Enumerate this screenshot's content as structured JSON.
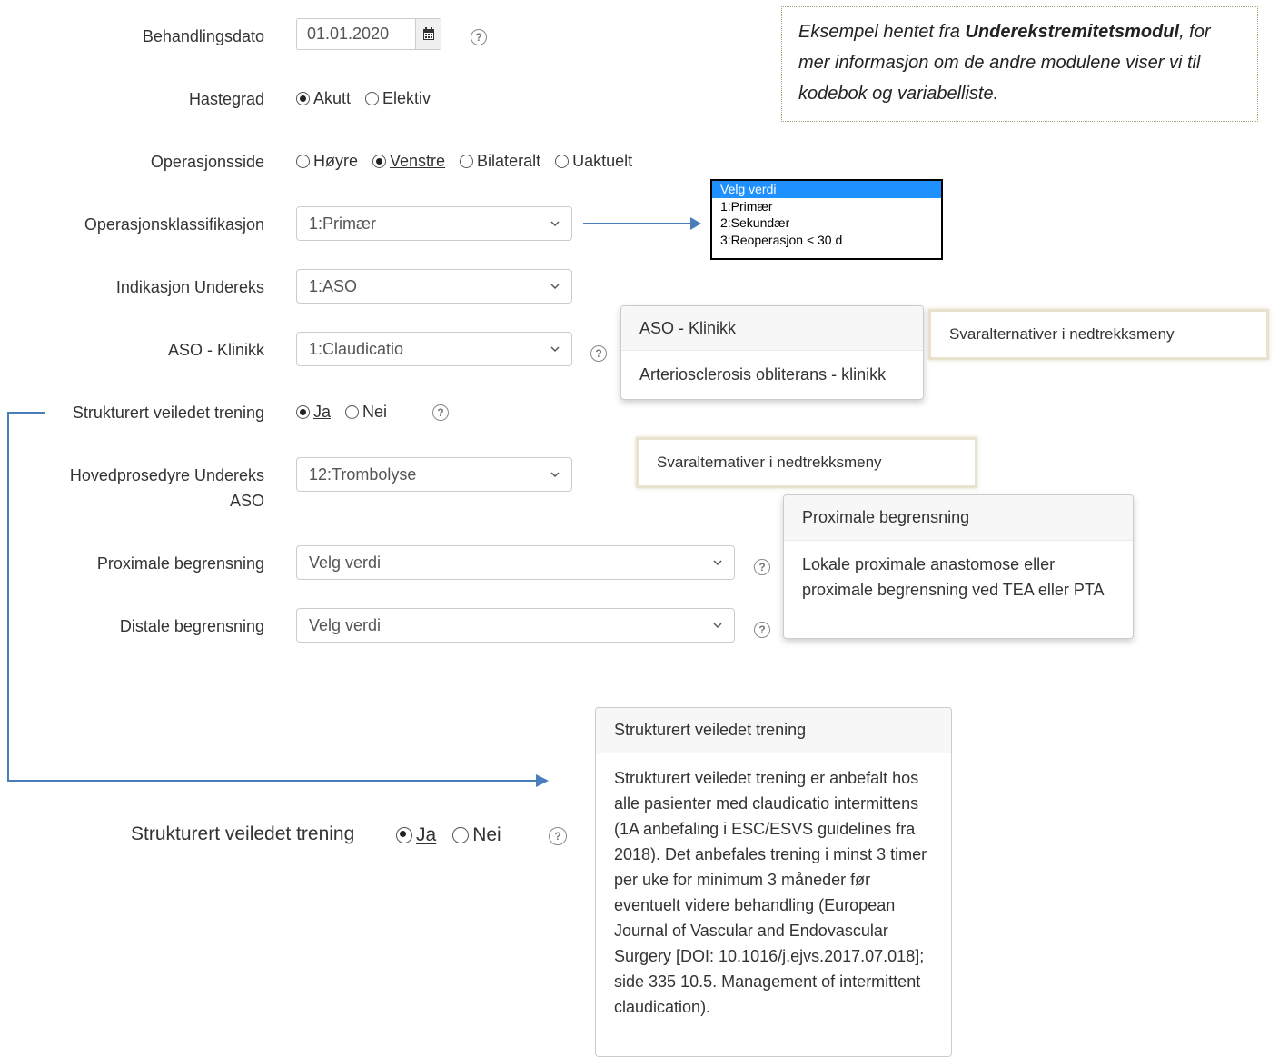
{
  "info": {
    "prefix": "Eksempel hentet fra ",
    "module": "Underekstremitetsmodul",
    "suffix": ", for mer informasjon om de andre modulene viser vi til kodebok og variabelliste."
  },
  "fields": {
    "behandlingsdato": {
      "label": "Behandlingsdato",
      "value": "01.01.2020"
    },
    "hastegrad": {
      "label": "Hastegrad",
      "options": [
        "Akutt",
        "Elektiv"
      ]
    },
    "operasjonsside": {
      "label": "Operasjonsside",
      "options": [
        "Høyre",
        "Venstre",
        "Bilateralt",
        "Uaktuelt"
      ]
    },
    "operasjonsklassifikasjon": {
      "label": "Operasjonsklassifikasjon",
      "value": "1:Primær"
    },
    "indikasjon": {
      "label": "Indikasjon Undereks",
      "value": "1:ASO"
    },
    "aso_klinikk": {
      "label": "ASO - Klinikk",
      "value": "1:Claudicatio"
    },
    "strukturert": {
      "label": "Strukturert veiledet trening",
      "options": [
        "Ja",
        "Nei"
      ]
    },
    "hovedprosedyre": {
      "label_line1": "Hovedprosedyre Undereks",
      "label_line2": "ASO",
      "value": "12:Trombolyse"
    },
    "proximale": {
      "label": "Proximale begrensning",
      "value": "Velg verdi"
    },
    "distale": {
      "label": "Distale begrensning",
      "value": "Velg verdi"
    }
  },
  "dropdown_list": [
    "Velg verdi",
    "1:Primær",
    "2:Sekundær",
    "3:Reoperasjon < 30 d"
  ],
  "popovers": {
    "aso": {
      "title": "ASO - Klinikk",
      "body": "Arteriosclerosis obliterans - klinikk"
    },
    "proximale": {
      "title": "Proximale begrensning",
      "body": "Lokale proximale anastomose eller proximale begrensning ved TEA eller PTA"
    },
    "strukturert": {
      "title": "Strukturert veiledet trening",
      "body": "Strukturert veiledet trening er anbefalt hos alle pasienter med claudicatio intermittens (1A anbefaling i ESC/ESVS guidelines fra 2018). Det anbefales trening i minst 3 timer per uke for minimum 3 måneder før eventuelt videre behandling (European Journal of Vascular and Endovascular Surgery [DOI: 10.1016/j.ejvs.2017.07.018]; side 335 10.5. Management of intermittent claudication)."
    }
  },
  "notes": {
    "dropdown_note": "Svaralternativer i nedtrekksmeny"
  },
  "help_glyph": "?",
  "icons": {
    "calendar": "calendar-icon",
    "chevron": "chevron-down-icon",
    "help": "question-circle-icon"
  },
  "colors": {
    "arrow": "#4a7ebb",
    "list_selected": "#1e90ff"
  }
}
